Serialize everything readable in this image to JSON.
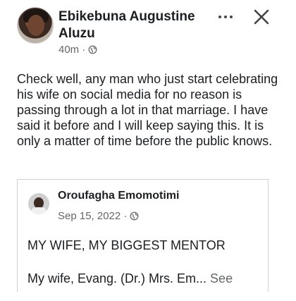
{
  "post": {
    "author": "Ebikebuna Augustine Aluzu",
    "time": "40m",
    "separator": "·",
    "privacy_icon": "globe-icon",
    "text": "Check well, any man who just start celebrating his wife on social media for no reason is passing through a lot in that marriage. I have said it before and I will keep saying this. It is only a matter of time before the public knows.",
    "actions": {
      "more_icon": "more-options-icon",
      "close_icon": "close-icon"
    }
  },
  "shared_post": {
    "author": "Oroufagha Emomotimi",
    "date": "Sep 15, 2022",
    "separator": "·",
    "privacy_icon": "globe-icon",
    "headline": "MY WIFE, MY BIGGEST MENTOR",
    "body": "My wife, Evang. (Dr.) Mrs. Em...",
    "see_more": "See"
  },
  "colors": {
    "text": "#1c1e21",
    "secondary": "#65676b",
    "border": "#cfd2d6"
  }
}
